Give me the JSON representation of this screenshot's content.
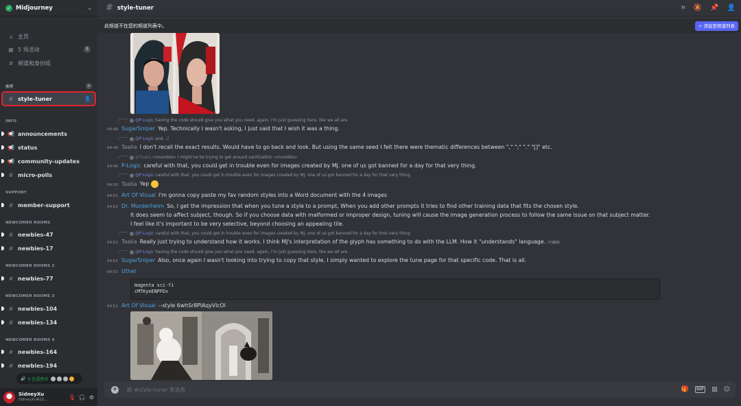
{
  "server": {
    "name": "Midjourney"
  },
  "sidebar": {
    "top_items": [
      {
        "label": "主页",
        "icon": "home-icon"
      },
      {
        "label": "5 场活动",
        "icon": "calendar-icon",
        "badge": "5"
      },
      {
        "label": "频道和身份组",
        "icon": "channels-roles-icon"
      }
    ],
    "recommended_header": "推荐",
    "selected_channel": "style-tuner",
    "sections": [
      {
        "title": "INFO",
        "channels": [
          "announcements",
          "status",
          "community-updates",
          "micro-polls"
        ]
      },
      {
        "title": "SUPPORT",
        "channels": [
          "member-support"
        ]
      },
      {
        "title": "NEWCOMER ROOMS",
        "channels": [
          "newbies-47",
          "newbies-17"
        ]
      },
      {
        "title": "NEWCOMER ROOMS 2",
        "channels": [
          "newbies-77"
        ]
      },
      {
        "title": "NEWCOMER ROOMS 3",
        "channels": [
          "newbies-104",
          "newbies-134"
        ]
      },
      {
        "title": "NEWCOMER ROOMS 4",
        "channels": [
          "newbies-164",
          "newbies-194"
        ]
      }
    ],
    "voice_status": "9 在语音中"
  },
  "user": {
    "name": "SidneyXu",
    "tag": "SidneyXu#21..."
  },
  "channel": {
    "name": "style-tuner"
  },
  "notice": {
    "text": "此频道不在您的频道列表中。",
    "button": "+ 添加至频道列表"
  },
  "messages": {
    "r1": {
      "mention": "@P-Logic",
      "text": "having the code should give you what you need. again, i'm just guessing here, like we all are."
    },
    "m1": {
      "time": "04:49",
      "author": "SugarSniper",
      "text": "Yep. Technically I wasn't asking, I just said that I wish it was a thing."
    },
    "r2": {
      "mention": "@P-Logic",
      "text": "and...?"
    },
    "m2": {
      "time": "04:49",
      "author": "Taalia",
      "text": "I don't recall the exact results. Would have to go back and look. But using the same seed I felt there were thematic differences between \",\" \";\" \".\" \"[]\" etc."
    },
    "r3": {
      "mention": "@Taalia",
      "text": "<mumble> I might've be trying to get around sanitization <mumble>"
    },
    "m3": {
      "time": "04:49",
      "author": "P-Logic",
      "text": "careful with that, you could get in trouble even for images created by MJ. one of us got banned for a day for that very thing."
    },
    "r4": {
      "mention": "@P-Logic",
      "text": "careful with that, you could get in trouble even for images created by MJ. one of us got banned for a day for that very thing."
    },
    "m4": {
      "time": "04:50",
      "author": "Taalia",
      "text": "Yep"
    },
    "m5": {
      "time": "04:51",
      "author": "Art Of Visual",
      "text": "I'm gonna copy paste my fav random styles into a Word document with the 4 images"
    },
    "m6": {
      "time": "04:51",
      "author": "Dr. Murderheim",
      "text": "So, I get the impression that when you tune a style to a prompt, When you add other prompts it tries to find other training data that fits the chosen style.",
      "line2": "It does seem to affect subject, though. So if you choose data with malformed or improper design, tuning will cause the image generation process to follow the same issue on that subject matter.",
      "line3": "I feel like it's important to be very selective, beyond choosing an appealing tile."
    },
    "r5": {
      "mention": "@P-Logic",
      "text": "careful with that, you could get in trouble even for images created by MJ. one of us got banned for a day for that very thing."
    },
    "m7": {
      "time": "04:51",
      "author": "Taalia",
      "text": "Really just trying to understand how it works. I think MJ's interpretation of the glyph has something to do with the LLM. How it \"understands\" language.",
      "edited": "(已编辑)"
    },
    "r6": {
      "mention": "@P-Logic",
      "text": "having the code should give you what you need. again, i'm just guessing here, like we all are."
    },
    "m8": {
      "time": "04:51",
      "author": "SugarSniper",
      "text": "Also, once again I wasn't looking into trying to copy that style, I simply wanted to explore the tune page for that specific code. That is all."
    },
    "m9": {
      "time": "04:51",
      "author": "Uthel",
      "code_line1": "magenta sci-fi",
      "code_line2": "cMTKyeENPFDs"
    },
    "m10": {
      "time": "04:51",
      "author": "Art Of Visual",
      "text": "--style 6whSr8PlAqyVlcOl"
    }
  },
  "composer": {
    "placeholder": "给 #style-tuner 发消息"
  },
  "colors": {
    "accent": "#5865f2",
    "link": "#4fa3e0",
    "selected_outline": "#e3222e",
    "online": "#23a55a"
  }
}
